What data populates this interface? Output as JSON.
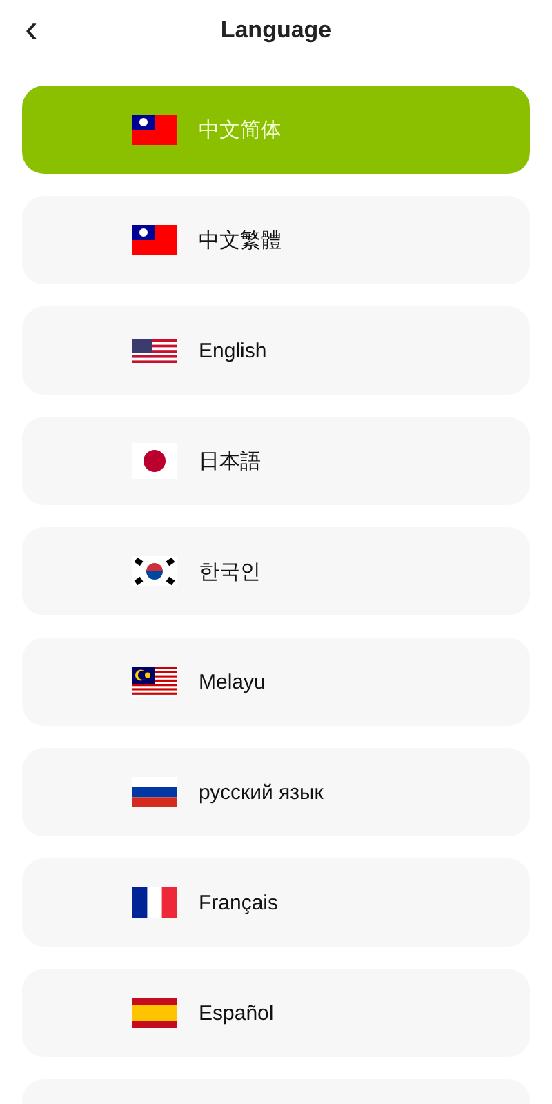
{
  "header": {
    "back_icon": "‹",
    "title": "Language"
  },
  "languages": [
    {
      "label": "中文简体",
      "kind": "tw",
      "selected": true
    },
    {
      "label": "中文繁體",
      "kind": "tw",
      "selected": false
    },
    {
      "label": "English",
      "kind": "us",
      "selected": false
    },
    {
      "label": "日本語",
      "kind": "jp",
      "selected": false
    },
    {
      "label": "한국인",
      "kind": "kr",
      "selected": false
    },
    {
      "label": "Melayu",
      "kind": "my",
      "selected": false
    },
    {
      "label": "русский язык",
      "kind": "ru",
      "selected": false
    },
    {
      "label": "Français",
      "kind": "fr",
      "selected": false
    },
    {
      "label": "Español",
      "kind": "es",
      "selected": false
    }
  ]
}
